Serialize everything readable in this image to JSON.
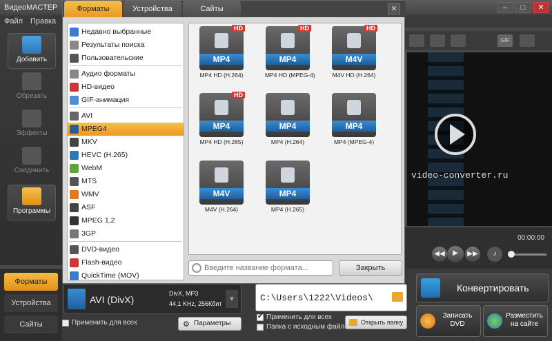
{
  "app": {
    "title": "ВидеоМАСТЕР"
  },
  "menu": [
    "Файл",
    "Правка"
  ],
  "window_buttons": [
    "–",
    "□",
    "✕"
  ],
  "left_tools": [
    {
      "label": "Добавить",
      "icon": "add-video-icon",
      "active": true
    },
    {
      "label": "Обрезать",
      "icon": "cut-icon",
      "active": false
    },
    {
      "label": "Эффекты",
      "icon": "effects-icon",
      "active": false
    },
    {
      "label": "Соединить",
      "icon": "join-icon",
      "active": false
    },
    {
      "label": "Программы",
      "icon": "programs-icon",
      "active": true
    }
  ],
  "bottom_tabs": [
    "Форматы",
    "Устройства",
    "Сайты"
  ],
  "dialog": {
    "tabs": [
      "Форматы",
      "Устройства",
      "Сайты"
    ],
    "close_glyph": "✕",
    "format_list": [
      {
        "label": "Недавно выбранные",
        "icon": "recent-icon",
        "color": "#3a7bd5"
      },
      {
        "label": "Результаты поиска",
        "icon": "search-icon",
        "color": "#888888"
      },
      {
        "label": "Пользовательские",
        "icon": "user-icon",
        "color": "#555555"
      },
      {
        "label": "Аудио форматы",
        "icon": "audio-icon",
        "color": "#888888"
      },
      {
        "label": "HD-видео",
        "icon": "hd-icon",
        "color": "#d33333"
      },
      {
        "label": "GIF-анимация",
        "icon": "gif-icon",
        "color": "#4a90d9"
      },
      {
        "label": "AVI",
        "icon": "avi-icon",
        "color": "#666666"
      },
      {
        "label": "MPEG4",
        "icon": "mp4-icon",
        "color": "#1f5f9e"
      },
      {
        "label": "MKV",
        "icon": "mkv-icon",
        "color": "#444444"
      },
      {
        "label": "HEVC (H.265)",
        "icon": "hevc-icon",
        "color": "#2b77b8"
      },
      {
        "label": "WebM",
        "icon": "webm-icon",
        "color": "#5aa832"
      },
      {
        "label": "MTS",
        "icon": "mts-icon",
        "color": "#555555"
      },
      {
        "label": "WMV",
        "icon": "wmv-icon",
        "color": "#e07a1a"
      },
      {
        "label": "ASF",
        "icon": "asf-icon",
        "color": "#444444"
      },
      {
        "label": "MPEG 1,2",
        "icon": "mpeg-icon",
        "color": "#333333"
      },
      {
        "label": "3GP",
        "icon": "3gp-icon",
        "color": "#777777"
      },
      {
        "label": "DVD-видео",
        "icon": "dvd-icon",
        "color": "#555555"
      },
      {
        "label": "Flash-видео",
        "icon": "flash-icon",
        "color": "#d33333"
      },
      {
        "label": "QuickTime (MOV)",
        "icon": "quicktime-icon",
        "color": "#3a7bd5"
      }
    ],
    "selected_format": "MPEG4",
    "tiles": [
      {
        "badge": "MP4",
        "hd": "HD",
        "label": "MP4 HD (H.264)"
      },
      {
        "badge": "MP4",
        "hd": "HD",
        "label": "MP4 HD (MPEG-4)"
      },
      {
        "badge": "M4V",
        "hd": "HD",
        "label": "M4V HD (H.264)"
      },
      {
        "badge": "MP4",
        "hd": "HD",
        "label": "MP4 HD (H.265)"
      },
      {
        "badge": "MP4",
        "hd": null,
        "label": "MP4 (H.264)"
      },
      {
        "badge": "MP4",
        "hd": null,
        "label": "MP4 (MPEG-4)"
      },
      {
        "badge": "M4V",
        "hd": null,
        "label": "M4V (H.264)"
      },
      {
        "badge": "MP4",
        "hd": null,
        "label": "MP4 (H.265)"
      }
    ],
    "search_placeholder": "Введите название формата...",
    "close_label": "Закрыть"
  },
  "preview": {
    "watermark": "video-converter.ru",
    "time": "00:00:00",
    "toolbar_icons": [
      "brightness-icon",
      "film-icon",
      "speed-icon",
      "gif-icon",
      "crop-icon"
    ],
    "player_buttons": [
      "prev-icon",
      "play-icon",
      "next-icon",
      "volume-icon"
    ]
  },
  "output": {
    "format_name": "AVI (DivX)",
    "format_detail1": "DivX, MP3",
    "format_detail2": "44,1 KHz, 256Кбит",
    "apply_all": "Применить для всех",
    "params_label": "Параметры",
    "path": "C:\\Users\\1222\\Videos\\",
    "apply_all_right": "Применить для всех",
    "source_folder": "Папка с исходным файлом",
    "open_folder": "Открыть папку",
    "convert": "Конвертировать",
    "burn_dvd": "Записать DVD",
    "publish": "Разместить на сайте"
  }
}
